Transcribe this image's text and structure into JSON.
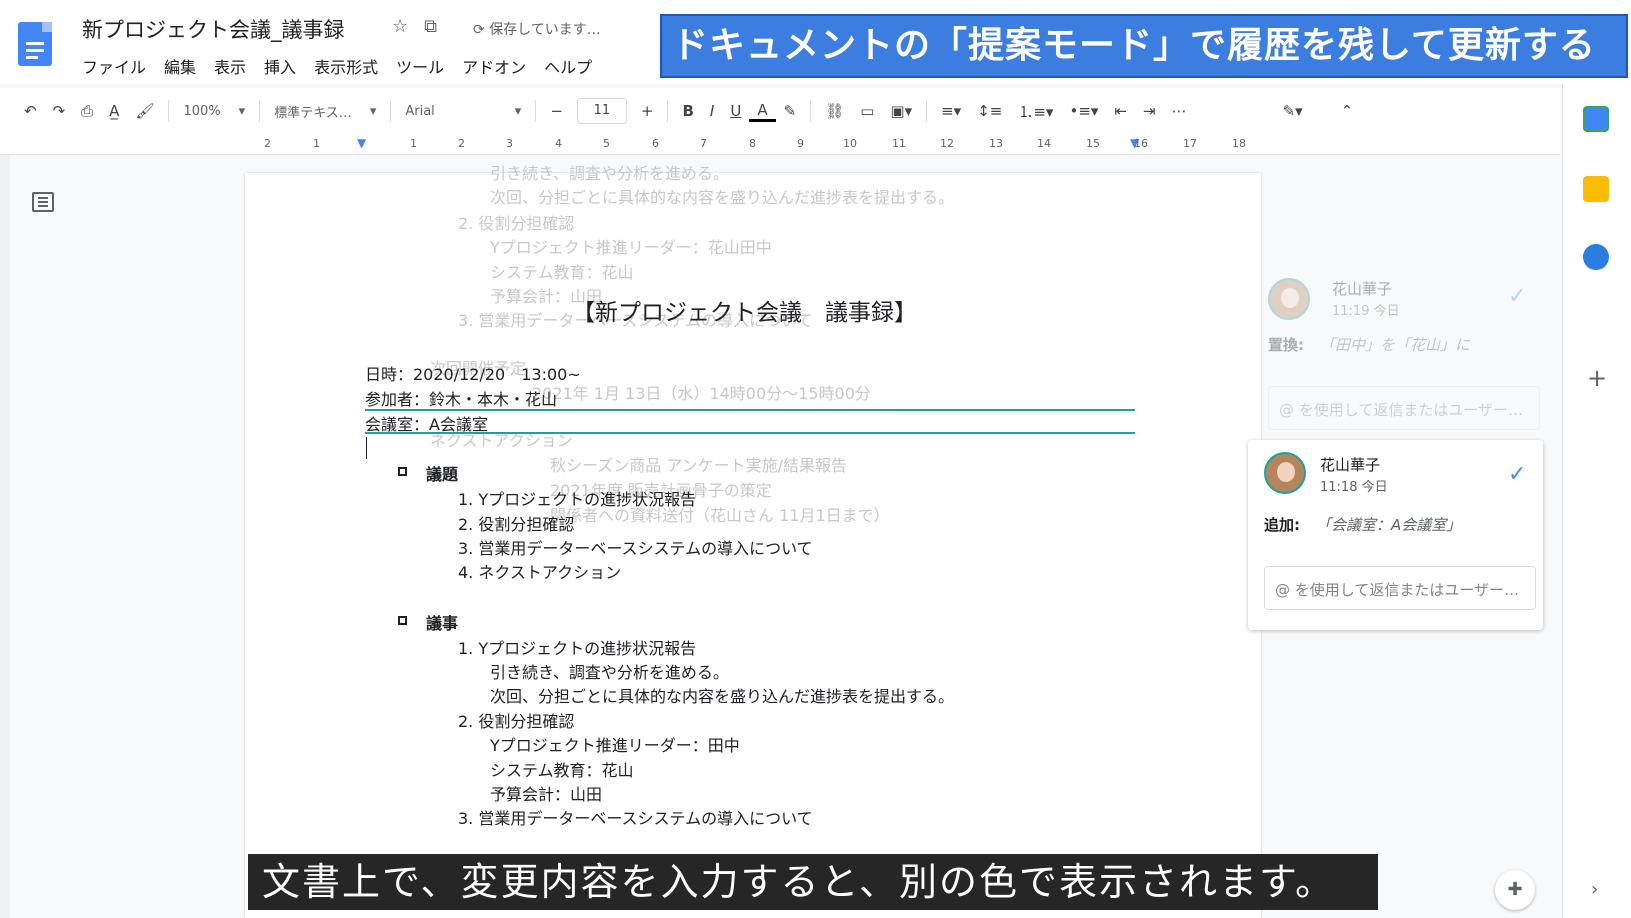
{
  "app": {
    "doc_title": "新プロジェクト会議_議事録",
    "saving_status": "保存しています…",
    "menu": [
      "ファイル",
      "編集",
      "表示",
      "挿入",
      "表示形式",
      "ツール",
      "アドオン",
      "ヘルプ"
    ]
  },
  "banner": "ドキュメントの「提案モード」で履歴を残して更新する",
  "toolbar": {
    "zoom": "100%",
    "style": "標準テキス…",
    "font": "Arial",
    "font_size": "11",
    "more": "⋯"
  },
  "ruler_ticks": [
    "2",
    "1",
    "1",
    "2",
    "3",
    "4",
    "5",
    "6",
    "7",
    "8",
    "9",
    "10",
    "11",
    "12",
    "13",
    "14",
    "15",
    "16",
    "17",
    "18"
  ],
  "ghost_text": {
    "l1": "引き続き、調査や分析を進める。",
    "l2": "次回、分担ごとに具体的な内容を盛り込んだ進捗表を提出する。",
    "l3": "2.  役割分担確認",
    "l4": "Yプロジェクト推進リーダー：花山田中",
    "l5": "システム教育：花山",
    "l6": "予算会計：山田",
    "l7": "3.  営業用データーベースシステムの導入について",
    "l8": "次回開催予定",
    "l9": "2021年 1月 13日（水）14時00分～15時00分",
    "l10": "ネクストアクション",
    "l11": "秋シーズン商品  アンケート実施/結果報告",
    "l12": "2021年度 販売計画骨子の策定",
    "l13": "関係者への資料送付（花山さん 11月1日まで）"
  },
  "document": {
    "heading": "【新プロジェクト会議　議事録】",
    "date_line": "日時：2020/12/20　13:00~",
    "attendees_line": "参加者：鈴木・本木・花山",
    "room_line": "会議室：A会議室",
    "agenda_title": "議題",
    "agenda": [
      "1.  Yプロジェクトの進捗状況報告",
      "2.  役割分担確認",
      "3.  営業用データーベースシステムの導入について",
      "4.  ネクストアクション"
    ],
    "minutes_title": "議事",
    "minutes": {
      "m1": "1.  Yプロジェクトの進捗状況報告",
      "m1a": "引き続き、調査や分析を進める。",
      "m1b": "次回、分担ごとに具体的な内容を盛り込んだ進捗表を提出する。",
      "m2": "2.  役割分担確認",
      "m2a": "Yプロジェクト推進リーダー：田中",
      "m2b": "システム教育：花山",
      "m2c": "予算会計：山田",
      "m3": "3.  営業用データーベースシステムの導入について"
    }
  },
  "comments": {
    "faded": {
      "name": "花山華子",
      "time": "11:19 今日",
      "label": "置換:",
      "value": "「田中」を「花山」に",
      "reply_placeholder": "@ を使用して返信またはユーザー…"
    },
    "active": {
      "name": "花山華子",
      "time": "11:18 今日",
      "label": "追加:",
      "value": "「会議室：A会議室」",
      "reply_placeholder": "@ を使用して返信またはユーザー…"
    }
  },
  "caption": "文書上で、変更内容を入力すると、別の色で表示されます。",
  "colors": {
    "banner": "#3c7de0",
    "suggestion": "#1aa39a",
    "accent": "#4285f4"
  }
}
